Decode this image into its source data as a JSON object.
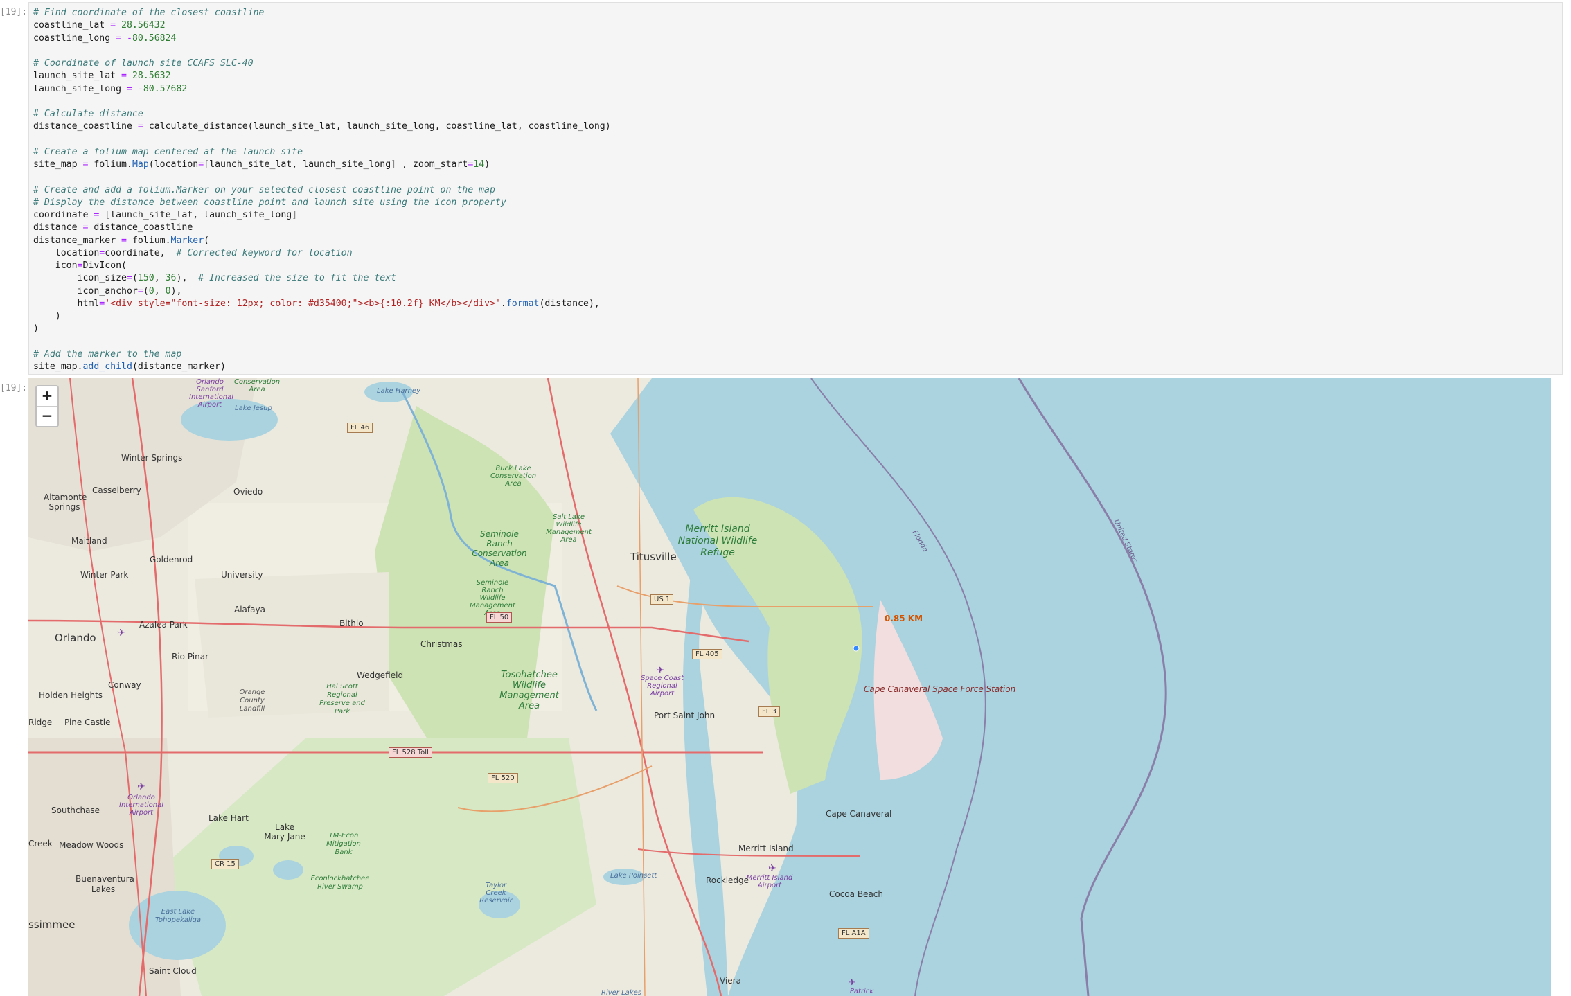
{
  "prompts": {
    "input": "[19]:",
    "output": "[19]:"
  },
  "code_lines": [
    [
      [
        "cm",
        "# Find coordinate of the closest coastline"
      ]
    ],
    [
      [
        "",
        "coastline_lat "
      ],
      [
        "op",
        "="
      ],
      [
        "nm",
        " 28.56432"
      ]
    ],
    [
      [
        "",
        "coastline_long "
      ],
      [
        "op",
        "="
      ],
      [
        "op",
        " -"
      ],
      [
        "nm",
        "80.56824"
      ]
    ],
    [
      [
        "",
        ""
      ]
    ],
    [
      [
        "cm",
        "# Coordinate of launch site CCAFS SLC-40"
      ]
    ],
    [
      [
        "",
        "launch_site_lat "
      ],
      [
        "op",
        "="
      ],
      [
        "nm",
        " 28.5632"
      ]
    ],
    [
      [
        "",
        "launch_site_long "
      ],
      [
        "op",
        "="
      ],
      [
        "op",
        " -"
      ],
      [
        "nm",
        "80.57682"
      ]
    ],
    [
      [
        "",
        ""
      ]
    ],
    [
      [
        "cm",
        "# Calculate distance"
      ]
    ],
    [
      [
        "",
        "distance_coastline "
      ],
      [
        "op",
        "="
      ],
      [
        "",
        ""
      ],
      [
        "",
        " calculate_distance(launch_site_lat, launch_site_long, coastline_lat, coastline_long)"
      ]
    ],
    [
      [
        "",
        ""
      ]
    ],
    [
      [
        "cm",
        "# Create a folium map centered at the launch site"
      ]
    ],
    [
      [
        "",
        "site_map "
      ],
      [
        "op",
        "="
      ],
      [
        "",
        " folium."
      ],
      [
        "fn",
        "Map"
      ],
      [
        "",
        "(location"
      ],
      [
        "op",
        "="
      ],
      [
        "br",
        "["
      ],
      [
        "",
        "launch_site_lat, launch_site_long"
      ],
      [
        "br",
        "]"
      ],
      [
        "",
        " , zoom_start"
      ],
      [
        "op",
        "="
      ],
      [
        "nm",
        "14"
      ],
      [
        "",
        ")"
      ]
    ],
    [
      [
        "",
        ""
      ]
    ],
    [
      [
        "cm",
        "# Create and add a folium.Marker on your selected closest coastline point on the map"
      ]
    ],
    [
      [
        "cm",
        "# Display the distance between coastline point and launch site using the icon property"
      ]
    ],
    [
      [
        "",
        "coordinate "
      ],
      [
        "op",
        "="
      ],
      [
        "",
        " "
      ],
      [
        "br",
        "["
      ],
      [
        "",
        "launch_site_lat, launch_site_long"
      ],
      [
        "br",
        "]"
      ]
    ],
    [
      [
        "",
        "distance "
      ],
      [
        "op",
        "="
      ],
      [
        "",
        " distance_coastline"
      ]
    ],
    [
      [
        "",
        "distance_marker "
      ],
      [
        "op",
        "="
      ],
      [
        "",
        " folium."
      ],
      [
        "fn",
        "Marker"
      ],
      [
        "",
        "("
      ]
    ],
    [
      [
        "",
        "    location"
      ],
      [
        "op",
        "="
      ],
      [
        "",
        "coordinate,  "
      ],
      [
        "cm",
        "# Corrected keyword for location"
      ]
    ],
    [
      [
        "",
        "    icon"
      ],
      [
        "op",
        "="
      ],
      [
        "",
        "DivIcon("
      ]
    ],
    [
      [
        "",
        "        icon_size"
      ],
      [
        "op",
        "="
      ],
      [
        "",
        "("
      ],
      [
        "nm",
        "150"
      ],
      [
        "",
        ", "
      ],
      [
        "nm",
        "36"
      ],
      [
        "",
        "),  "
      ],
      [
        "cm",
        "# Increased the size to fit the text"
      ]
    ],
    [
      [
        "",
        "        icon_anchor"
      ],
      [
        "op",
        "="
      ],
      [
        "",
        "("
      ],
      [
        "nm",
        "0"
      ],
      [
        "",
        ", "
      ],
      [
        "nm",
        "0"
      ],
      [
        "",
        "),"
      ]
    ],
    [
      [
        "",
        "        html"
      ],
      [
        "op",
        "="
      ],
      [
        "st",
        "'<div style=\"font-size: 12px; color: #d35400;\"><b>{:10.2f} KM</b></div>'"
      ],
      [
        "",
        "."
      ],
      [
        "fn",
        "format"
      ],
      [
        "",
        "(distance),"
      ]
    ],
    [
      [
        "",
        "    )"
      ]
    ],
    [
      [
        "",
        ")"
      ]
    ],
    [
      [
        "",
        ""
      ]
    ],
    [
      [
        "cm",
        "# Add the marker to the map"
      ]
    ],
    [
      [
        "",
        "site_map."
      ],
      [
        "fn",
        "add_child"
      ],
      [
        "",
        "(distance_marker)"
      ]
    ]
  ],
  "map": {
    "zoom_in": "+",
    "zoom_out": "−",
    "marker_text": "0.85 KM",
    "marker_color": "#d35400",
    "colors": {
      "ocean": "#aad3df",
      "land": "#eceadf",
      "park": "#cde3b4",
      "road": "#e46b6b",
      "border": "#8a7fa8"
    },
    "cities": [
      {
        "id": "orlando",
        "name": "Orlando"
      },
      {
        "id": "titusville",
        "name": "Titusville"
      },
      {
        "id": "winter-springs",
        "name": "Winter Springs"
      },
      {
        "id": "casselberry",
        "name": "Casselberry"
      },
      {
        "id": "oviedo",
        "name": "Oviedo"
      },
      {
        "id": "altamonte",
        "name": "Altamonte Springs"
      },
      {
        "id": "maitland",
        "name": "Maitland"
      },
      {
        "id": "goldenrod",
        "name": "Goldenrod"
      },
      {
        "id": "winter-park",
        "name": "Winter Park"
      },
      {
        "id": "university",
        "name": "University"
      },
      {
        "id": "alafaya",
        "name": "Alafaya"
      },
      {
        "id": "azalea-park",
        "name": "Azalea Park"
      },
      {
        "id": "rio-pinar",
        "name": "Rio Pinar"
      },
      {
        "id": "bithlo",
        "name": "Bithlo"
      },
      {
        "id": "christmas",
        "name": "Christmas"
      },
      {
        "id": "wedgefield",
        "name": "Wedgefield"
      },
      {
        "id": "conway",
        "name": "Conway"
      },
      {
        "id": "holden-heights",
        "name": "Holden Heights"
      },
      {
        "id": "pine-castle",
        "name": "Pine Castle"
      },
      {
        "id": "ridge",
        "name": "Ridge"
      },
      {
        "id": "port-saint-john",
        "name": "Port Saint John"
      },
      {
        "id": "southchase",
        "name": "Southchase"
      },
      {
        "id": "lake-hart",
        "name": "Lake Hart"
      },
      {
        "id": "lake-mary-jane",
        "name": "Lake Mary Jane"
      },
      {
        "id": "creek",
        "name": "Creek"
      },
      {
        "id": "meadow-woods",
        "name": "Meadow Woods"
      },
      {
        "id": "buenaventura",
        "name": "Buenaventura Lakes"
      },
      {
        "id": "kissimmee",
        "name": "ssimmee"
      },
      {
        "id": "saint-cloud",
        "name": "Saint Cloud"
      },
      {
        "id": "cape-canaveral",
        "name": "Cape Canaveral"
      },
      {
        "id": "merritt-island",
        "name": "Merritt Island"
      },
      {
        "id": "rockledge",
        "name": "Rockledge"
      },
      {
        "id": "cocoa-beach",
        "name": "Cocoa Beach"
      },
      {
        "id": "viera",
        "name": "Viera"
      }
    ],
    "parks": [
      {
        "id": "merritt-refuge",
        "name": "Merritt Island National Wildlife Refuge"
      },
      {
        "id": "seminole-ranch",
        "name": "Seminole Ranch Conservation Area"
      },
      {
        "id": "seminole-ranch-wma",
        "name": "Seminole Ranch Wildlife Management Area"
      },
      {
        "id": "buck-lake",
        "name": "Buck Lake Conservation Area"
      },
      {
        "id": "salt-lake",
        "name": "Salt Lake Wildlife Management Area"
      },
      {
        "id": "tosohatchee",
        "name": "Tosohatchee Wildlife Management Area"
      },
      {
        "id": "hal-scott",
        "name": "Hal Scott Regional Preserve and Park"
      },
      {
        "id": "orange-landfill",
        "name": "Orange County Landfill"
      },
      {
        "id": "tm-econ",
        "name": "TM-Econ Mitigation Bank"
      },
      {
        "id": "econlockhatchee",
        "name": "Econlockhatchee River Swamp"
      },
      {
        "id": "conservation",
        "name": "Conservation Area"
      },
      {
        "id": "orlando-sanford",
        "name": "Orlando Sanford International Airport"
      },
      {
        "id": "space-coast",
        "name": "Space Coast Regional Airport"
      },
      {
        "id": "orlando-intl",
        "name": "Orlando International Airport"
      },
      {
        "id": "merritt-airport",
        "name": "Merritt Island Airport"
      },
      {
        "id": "cape-station",
        "name": "Cape Canaveral Space Force Station"
      },
      {
        "id": "patrick",
        "name": "Patrick"
      }
    ],
    "water": [
      {
        "id": "lake-harney",
        "name": "Lake Harney"
      },
      {
        "id": "lake-jesup",
        "name": "Lake Jesup"
      },
      {
        "id": "east-lake",
        "name": "East Lake Tohopekaliga"
      },
      {
        "id": "lake-poinsett",
        "name": "Lake Poinsett"
      },
      {
        "id": "taylor-creek",
        "name": "Taylor Creek Reservoir"
      },
      {
        "id": "river-lakes",
        "name": "River Lakes"
      }
    ],
    "borders": [
      {
        "id": "florida",
        "name": "Florida"
      },
      {
        "id": "united-states",
        "name": "United States"
      }
    ],
    "shields": [
      {
        "id": "fl46",
        "name": "FL 46"
      },
      {
        "id": "fl50",
        "name": "FL 50"
      },
      {
        "id": "fl405",
        "name": "FL 405"
      },
      {
        "id": "us1",
        "name": "US 1"
      },
      {
        "id": "fl3",
        "name": "FL 3"
      },
      {
        "id": "fl528",
        "name": "FL 528 Toll"
      },
      {
        "id": "fl520",
        "name": "FL 520"
      },
      {
        "id": "cr15",
        "name": "CR 15"
      },
      {
        "id": "fla1a",
        "name": "FL A1A"
      }
    ]
  }
}
